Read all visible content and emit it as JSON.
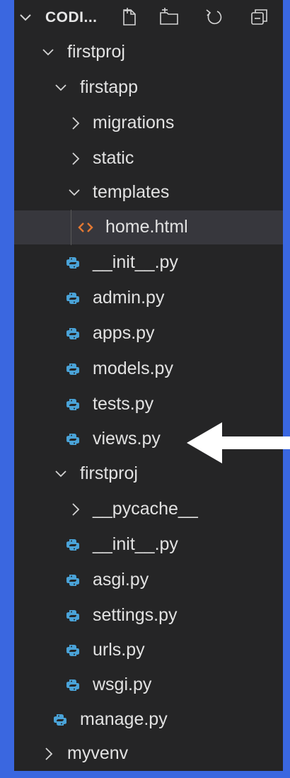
{
  "explorer": {
    "section_title": "CODI...",
    "toolbar": [
      "new-file",
      "new-folder",
      "refresh",
      "collapse-all"
    ]
  },
  "tree": [
    {
      "label": "firstproj",
      "type": "folder",
      "state": "expanded",
      "depth": 1
    },
    {
      "label": "firstapp",
      "type": "folder",
      "state": "expanded",
      "depth": 2
    },
    {
      "label": "migrations",
      "type": "folder",
      "state": "collapsed",
      "depth": 3
    },
    {
      "label": "static",
      "type": "folder",
      "state": "collapsed",
      "depth": 3
    },
    {
      "label": "templates",
      "type": "folder",
      "state": "expanded",
      "depth": 3
    },
    {
      "label": "home.html",
      "type": "html",
      "depth": 4,
      "selected": true
    },
    {
      "label": "__init__.py",
      "type": "python",
      "depth": 3
    },
    {
      "label": "admin.py",
      "type": "python",
      "depth": 3
    },
    {
      "label": "apps.py",
      "type": "python",
      "depth": 3
    },
    {
      "label": "models.py",
      "type": "python",
      "depth": 3
    },
    {
      "label": "tests.py",
      "type": "python",
      "depth": 3
    },
    {
      "label": "views.py",
      "type": "python",
      "depth": 3
    },
    {
      "label": "firstproj",
      "type": "folder",
      "state": "expanded",
      "depth": 2
    },
    {
      "label": "__pycache__",
      "type": "folder",
      "state": "collapsed",
      "depth": 3
    },
    {
      "label": "__init__.py",
      "type": "python",
      "depth": 3
    },
    {
      "label": "asgi.py",
      "type": "python",
      "depth": 3
    },
    {
      "label": "settings.py",
      "type": "python",
      "depth": 3
    },
    {
      "label": "urls.py",
      "type": "python",
      "depth": 3
    },
    {
      "label": "wsgi.py",
      "type": "python",
      "depth": 3
    },
    {
      "label": "manage.py",
      "type": "python",
      "depth": 2
    },
    {
      "label": "myvenv",
      "type": "folder",
      "state": "collapsed",
      "depth": 1
    }
  ],
  "colors": {
    "background_frame": "#3a67e0",
    "sidebar": "#252526",
    "selected_row": "#37373d",
    "text": "#e2e2e2",
    "python_icon": "#4aa3d8",
    "html_icon": "#e37933",
    "arrow": "#ffffff"
  }
}
